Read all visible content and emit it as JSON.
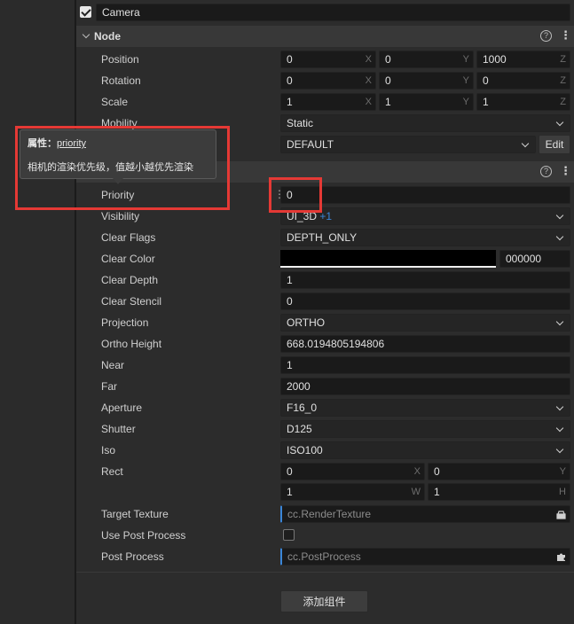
{
  "component_name": "Camera",
  "node": {
    "title": "Node",
    "position": {
      "label": "Position",
      "x": "0",
      "y": "0",
      "z": "1000"
    },
    "rotation": {
      "label": "Rotation",
      "x": "0",
      "y": "0",
      "z": "0"
    },
    "scale": {
      "label": "Scale",
      "x": "1",
      "y": "1",
      "z": "1"
    },
    "mobility": {
      "label": "Mobility",
      "value": "Static"
    },
    "layer": {
      "value": "DEFAULT",
      "edit_label": "Edit"
    }
  },
  "axis_labels": {
    "x": "X",
    "y": "Y",
    "z": "Z",
    "w": "W",
    "h": "H"
  },
  "icons": {
    "help": "?",
    "menu": "⋮"
  },
  "tooltip": {
    "prefix": "属性：",
    "property": "priority",
    "description": "相机的渲染优先级，值越小越优先渲染"
  },
  "camera": {
    "priority": {
      "label": "Priority",
      "value": "0"
    },
    "visibility": {
      "label": "Visibility",
      "value": "UI_3D",
      "extra": "+1"
    },
    "clear_flags": {
      "label": "Clear Flags",
      "value": "DEPTH_ONLY"
    },
    "clear_color": {
      "label": "Clear Color",
      "hex": "000000",
      "color": "#000000"
    },
    "clear_depth": {
      "label": "Clear Depth",
      "value": "1"
    },
    "clear_stencil": {
      "label": "Clear Stencil",
      "value": "0"
    },
    "projection": {
      "label": "Projection",
      "value": "ORTHO"
    },
    "ortho_height": {
      "label": "Ortho Height",
      "value": "668.0194805194806"
    },
    "near": {
      "label": "Near",
      "value": "1"
    },
    "far": {
      "label": "Far",
      "value": "2000"
    },
    "aperture": {
      "label": "Aperture",
      "value": "F16_0"
    },
    "shutter": {
      "label": "Shutter",
      "value": "D125"
    },
    "iso": {
      "label": "Iso",
      "value": "ISO100"
    },
    "rect": {
      "label": "Rect",
      "x": "0",
      "y": "0",
      "w": "1",
      "h": "1"
    },
    "target_texture": {
      "label": "Target Texture",
      "placeholder": "cc.RenderTexture"
    },
    "use_post_process": {
      "label": "Use Post Process",
      "checked": false
    },
    "post_process": {
      "label": "Post Process",
      "placeholder": "cc.PostProcess"
    }
  },
  "add_component_label": "添加组件",
  "colors": {
    "highlight": "#e53935",
    "accent": "#3b86d8"
  }
}
